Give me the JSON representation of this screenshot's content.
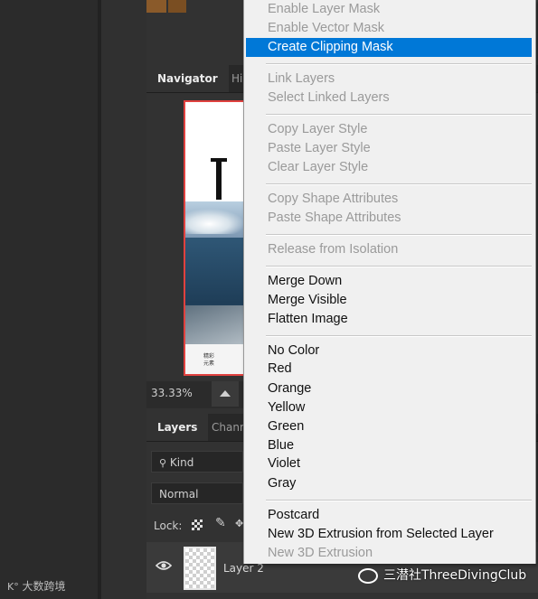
{
  "navigator": {
    "tabs": [
      "Navigator",
      "Hi"
    ],
    "zoom": "33.33%",
    "preview_text": "T",
    "preview_caption": [
      "精彩",
      "元素"
    ]
  },
  "layers_panel": {
    "tabs": [
      "Layers",
      "Chann"
    ],
    "filter_label": "Kind",
    "blend_mode": "Normal",
    "lock_label": "Lock:",
    "layer_name": "Layer 2"
  },
  "context_menu": {
    "items": [
      {
        "label": "Enable Layer Mask",
        "enabled": false
      },
      {
        "label": "Enable Vector Mask",
        "enabled": false
      },
      {
        "label": "Create Clipping Mask",
        "enabled": true,
        "highlighted": true
      },
      {
        "label": "Link Layers",
        "enabled": false
      },
      {
        "label": "Select Linked Layers",
        "enabled": false
      },
      {
        "label": "Copy Layer Style",
        "enabled": false
      },
      {
        "label": "Paste Layer Style",
        "enabled": false
      },
      {
        "label": "Clear Layer Style",
        "enabled": false
      },
      {
        "label": "Copy Shape Attributes",
        "enabled": false
      },
      {
        "label": "Paste Shape Attributes",
        "enabled": false
      },
      {
        "label": "Release from Isolation",
        "enabled": false
      },
      {
        "label": "Merge Down",
        "enabled": true
      },
      {
        "label": "Merge Visible",
        "enabled": true
      },
      {
        "label": "Flatten Image",
        "enabled": true
      },
      {
        "label": "No Color",
        "enabled": true
      },
      {
        "label": "Red",
        "enabled": true
      },
      {
        "label": "Orange",
        "enabled": true
      },
      {
        "label": "Yellow",
        "enabled": true
      },
      {
        "label": "Green",
        "enabled": true
      },
      {
        "label": "Blue",
        "enabled": true
      },
      {
        "label": "Violet",
        "enabled": true
      },
      {
        "label": "Gray",
        "enabled": true
      },
      {
        "label": "Postcard",
        "enabled": true
      },
      {
        "label": "New 3D Extrusion from Selected Layer",
        "enabled": true
      },
      {
        "label": "New 3D Extrusion",
        "enabled": false
      }
    ]
  },
  "watermarks": {
    "left": "大数跨境",
    "right": "三潜社ThreeDivingClub"
  },
  "colors": {
    "highlight": "#0078d7",
    "canvas_border": "#e0413f",
    "panel_bg": "#323232"
  }
}
